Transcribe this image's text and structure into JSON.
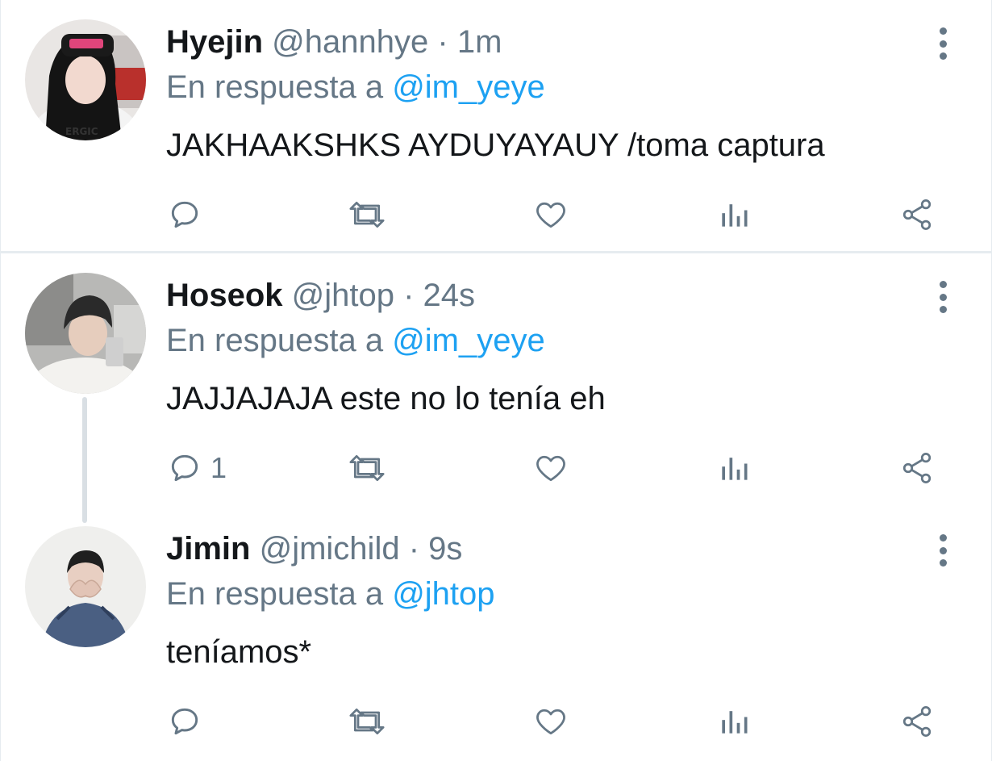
{
  "tweets": [
    {
      "name": "Hyejin",
      "handle": "@hannhye",
      "separator": "·",
      "time": "1m",
      "reply_prefix": "En respuesta a",
      "reply_to": "@im_yeye",
      "text": "JAKHAAKSHKS AYDUYAYAUY /toma captura",
      "reply_count": "",
      "avatar_icon": "avatar-photo",
      "avatar_caption": "ERGIC"
    },
    {
      "name": "Hoseok",
      "handle": "@jhtop",
      "separator": "·",
      "time": "24s",
      "reply_prefix": "En respuesta a",
      "reply_to": "@im_yeye",
      "text": "JAJJAJAJA este no lo tenía eh",
      "reply_count": "1",
      "avatar_icon": "avatar-photo"
    },
    {
      "name": "Jimin",
      "handle": "@jmichild",
      "separator": "·",
      "time": "9s",
      "reply_prefix": "En respuesta a",
      "reply_to": "@jhtop",
      "text": "teníamos*",
      "reply_count": "",
      "avatar_icon": "avatar-photo"
    }
  ],
  "icons": {
    "reply": "reply-icon",
    "retweet": "retweet-icon",
    "like": "heart-icon",
    "stats": "stats-icon",
    "share": "share-icon",
    "more": "more-vertical-icon"
  },
  "colors": {
    "text_primary": "#14171a",
    "text_secondary": "#657786",
    "link": "#1da1f2",
    "divider": "#e6ecf0",
    "thread_line": "#d9dfe4"
  }
}
